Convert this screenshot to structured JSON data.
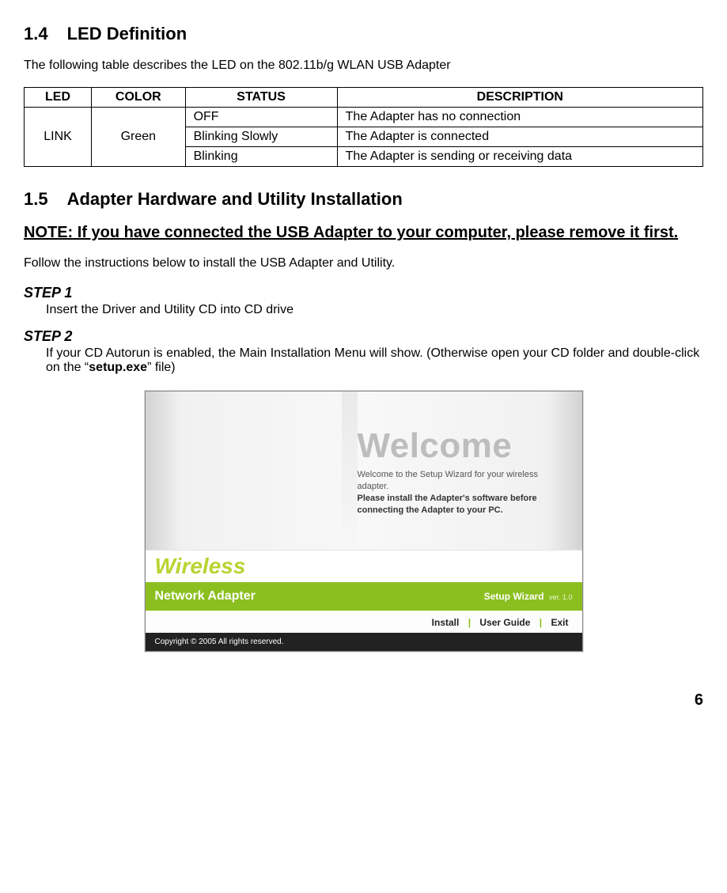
{
  "section14": {
    "number": "1.4",
    "title": "LED Definition",
    "intro": "The following table describes the LED on the 802.11b/g WLAN USB Adapter",
    "table": {
      "headers": {
        "c1": "LED",
        "c2": "COLOR",
        "c3": "STATUS",
        "c4": "DESCRIPTION"
      },
      "led": "LINK",
      "color": "Green",
      "rows": [
        {
          "status": "OFF",
          "desc": "The Adapter has no connection"
        },
        {
          "status": "Blinking Slowly",
          "desc": "The Adapter is connected"
        },
        {
          "status": "Blinking",
          "desc": "The Adapter is sending or receiving data"
        }
      ]
    }
  },
  "section15": {
    "number": "1.5",
    "title": "Adapter Hardware and Utility Installation",
    "note": "NOTE: If you have connected the USB Adapter to your computer, please remove it first.",
    "intro": "Follow the instructions below to install the USB Adapter and Utility.",
    "steps": [
      {
        "title": "STEP 1",
        "body_pre": "Insert the Driver and Utility CD into CD drive",
        "bold": "",
        "body_post": ""
      },
      {
        "title": "STEP 2",
        "body_pre": "If your CD Autorun is enabled, the Main Installation Menu will show. (Otherwise open your CD folder and double-click on the “",
        "bold": "setup.exe",
        "body_post": "” file)"
      }
    ]
  },
  "installer": {
    "welcome_big": "Welcome",
    "welcome_small": "Welcome to the Setup Wizard for your wireless adapter.",
    "welcome_bold": "Please install the Adapter's software before connecting the Adapter to your PC.",
    "wireless": "Wireless",
    "network_adapter": "Network Adapter",
    "setup_wizard": "Setup Wizard",
    "ver": "ver. 1.0",
    "links": {
      "install": "Install",
      "guide": "User Guide",
      "exit": "Exit"
    },
    "copyright": "Copyright © 2005 All rights reserved."
  },
  "page_number": "6"
}
